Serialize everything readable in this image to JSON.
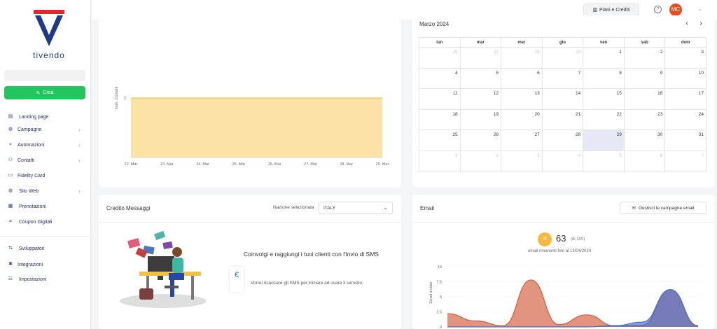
{
  "brand": {
    "name": "tivendo",
    "colors": {
      "accent": "#22c55e",
      "navy": "#1e3a8a",
      "red": "#e3262f"
    }
  },
  "sidebar": {
    "create_label": "Crea",
    "items": [
      {
        "label": "Landing page",
        "icon": "layout-icon",
        "has_submenu": false
      },
      {
        "label": "Campagne",
        "icon": "globe-icon",
        "has_submenu": true
      },
      {
        "label": "Automazioni",
        "icon": "flow-icon",
        "has_submenu": true
      },
      {
        "label": "Contatti",
        "icon": "contacts-icon",
        "has_submenu": true
      },
      {
        "label": "Fidelity Card",
        "icon": "card-icon",
        "has_submenu": false
      },
      {
        "label": "Sito Web",
        "icon": "globe-icon",
        "has_submenu": true
      },
      {
        "label": "Prenotazioni",
        "icon": "calendar-icon",
        "has_submenu": false
      },
      {
        "label": "Coupon Digitali",
        "icon": "coupon-icon",
        "has_submenu": false
      }
    ],
    "bottom_items": [
      {
        "label": "Sviluppatori",
        "icon": "code-icon"
      },
      {
        "label": "Integrazioni",
        "icon": "puzzle-icon"
      },
      {
        "label": "Impostazioni",
        "icon": "sliders-icon"
      }
    ]
  },
  "topbar": {
    "plans_label": "Piani e Crediti",
    "help_label": "?",
    "avatar_initials": "MC"
  },
  "contacts_chart": {
    "chart_data": {
      "type": "area",
      "x": [
        "22. Mar",
        "23. Mar",
        "24. Mar",
        "25. Mar",
        "26. Mar",
        "27. Mar",
        "28. Mar",
        "29. Mar"
      ],
      "values": [
        2,
        2,
        2,
        2,
        2,
        2,
        2,
        2
      ],
      "ylabel": "num. Contatti",
      "yticks": [
        "2"
      ],
      "color": "#fde2a6",
      "line_color": "#f3b73b"
    }
  },
  "calendar": {
    "title": "Marzo 2024",
    "prev_label": "‹",
    "next_label": "›",
    "weekdays": [
      "lun",
      "mar",
      "mer",
      "gio",
      "ven",
      "sab",
      "dom"
    ],
    "weeks": [
      [
        "26",
        "27",
        "28",
        "29",
        "1",
        "2",
        "3"
      ],
      [
        "4",
        "5",
        "6",
        "7",
        "8",
        "9",
        "10"
      ],
      [
        "11",
        "12",
        "13",
        "14",
        "15",
        "16",
        "17"
      ],
      [
        "18",
        "19",
        "20",
        "21",
        "22",
        "23",
        "24"
      ],
      [
        "25",
        "26",
        "27",
        "28",
        "29",
        "30",
        "31"
      ],
      [
        "1",
        "2",
        "3",
        "4",
        "5",
        "6",
        "7"
      ]
    ],
    "today": "29"
  },
  "sms": {
    "title": "Credito Messaggi",
    "nation_label": "Nazione selezionata",
    "nation_value": "ITALY",
    "headline": "Coinvolgi e raggiungi i tuoi clienti con l'invio di SMS",
    "recharge_text": "Vorrei ricaricare gli SMS per iniziare ad usare il servizio.",
    "currency_symbol": "€"
  },
  "email": {
    "title": "Email",
    "manage_label": "Gestisci le campagne email",
    "count": "63",
    "of_total": "(di 100)",
    "remaining_text": "email rimanenti fino al 13/04/2024",
    "chart_data": {
      "type": "area",
      "ylabel": "Email inviate",
      "ylim": [
        0,
        10
      ],
      "yticks": [
        "10",
        "7.5",
        "5",
        "2.5",
        "0"
      ],
      "series": [
        {
          "values": [
            2.2,
            1.0,
            0.2,
            7.8,
            0.4,
            2.0,
            0.2,
            0.3,
            6.2,
            0.2
          ],
          "color": "#d35b3a"
        },
        {
          "values": [
            0,
            0,
            0,
            0,
            0,
            0,
            0.2,
            0.8,
            6.2,
            0.1
          ],
          "color": "#3e6fd8"
        }
      ]
    }
  }
}
